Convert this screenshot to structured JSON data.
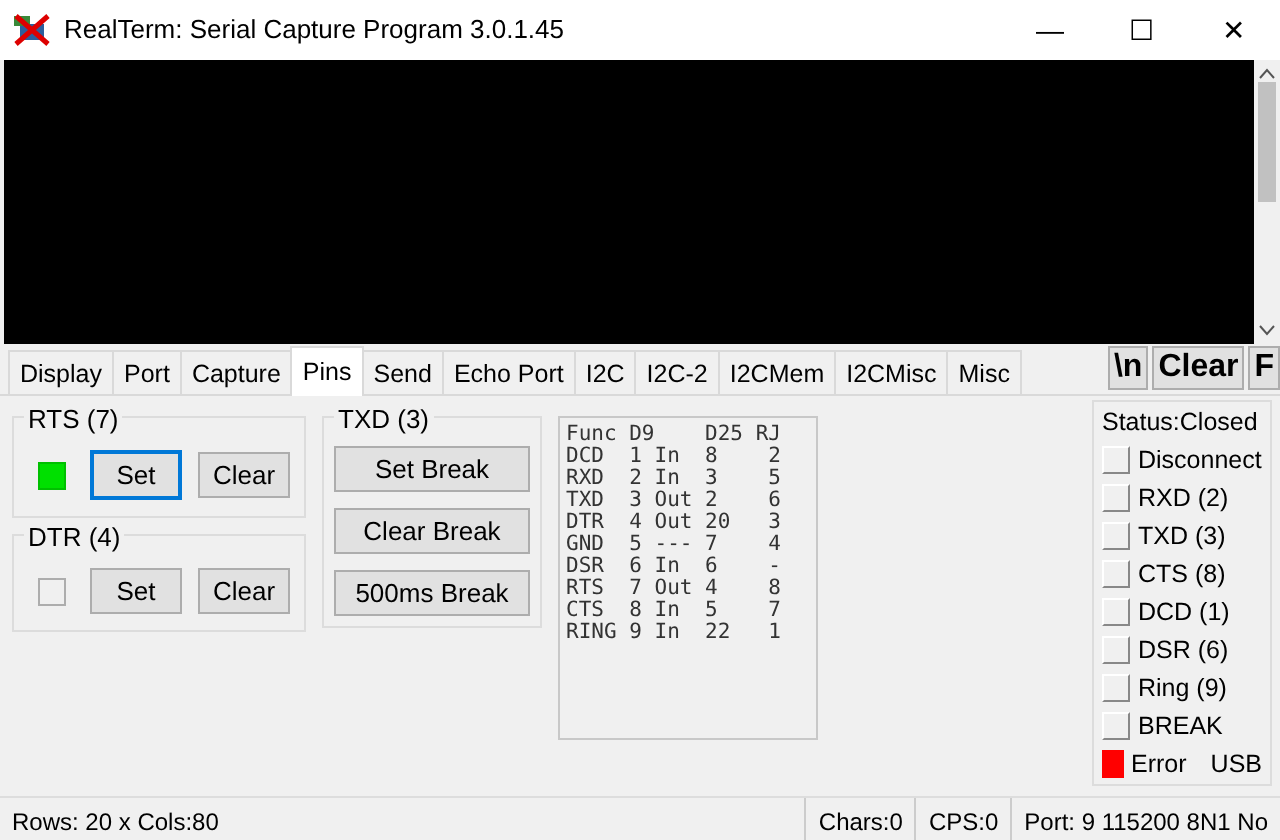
{
  "window": {
    "title": "RealTerm: Serial Capture Program 3.0.1.45",
    "controls": [
      "—",
      "☐",
      "✕"
    ]
  },
  "tabs": [
    {
      "label": "Display",
      "selected": false
    },
    {
      "label": "Port",
      "selected": false
    },
    {
      "label": "Capture",
      "selected": false
    },
    {
      "label": "Pins",
      "selected": true
    },
    {
      "label": "Send",
      "selected": false
    },
    {
      "label": "Echo Port",
      "selected": false
    },
    {
      "label": "I2C",
      "selected": false
    },
    {
      "label": "I2C-2",
      "selected": false
    },
    {
      "label": "I2CMem",
      "selected": false
    },
    {
      "label": "I2CMisc",
      "selected": false
    },
    {
      "label": "Misc",
      "selected": false
    }
  ],
  "tool_buttons": [
    "\\n",
    "Clear",
    "F"
  ],
  "line_groups": [
    {
      "title": "RTS (7)",
      "on": true,
      "buttons": [
        {
          "label": "Set",
          "focused": true
        },
        {
          "label": "Clear",
          "focused": false
        }
      ]
    },
    {
      "title": "DTR (4)",
      "on": false,
      "buttons": [
        {
          "label": "Set",
          "focused": false
        },
        {
          "label": "Clear",
          "focused": false
        }
      ]
    }
  ],
  "txd_group": {
    "title": "TXD (3)",
    "buttons": [
      "Set Break",
      "Clear Break",
      "500ms Break"
    ]
  },
  "pinout": [
    "Func D9    D25 RJ",
    "DCD  1 In  8    2",
    "RXD  2 In  3    5",
    "TXD  3 Out 2    6",
    "DTR  4 Out 20   3",
    "GND  5 --- 7    4",
    "DSR  6 In  6    -",
    "RTS  7 Out 4    8",
    "CTS  8 In  5    7",
    "RING 9 In  22   1"
  ],
  "status": {
    "title": "Status:Closed",
    "indicators": [
      {
        "label": "Disconnect",
        "on": false
      },
      {
        "label": "RXD (2)",
        "on": false
      },
      {
        "label": "TXD (3)",
        "on": false
      },
      {
        "label": "CTS (8)",
        "on": false
      },
      {
        "label": "DCD (1)",
        "on": false
      },
      {
        "label": "DSR (6)",
        "on": false
      },
      {
        "label": "Ring (9)",
        "on": false
      },
      {
        "label": "BREAK",
        "on": false
      },
      {
        "label": "Error",
        "on": true,
        "extra": "USB"
      }
    ]
  },
  "status_bar": [
    "Rows: 20 x Cols:80",
    "Chars:0",
    "CPS:0",
    "Port: 9  115200 8N1 No"
  ]
}
